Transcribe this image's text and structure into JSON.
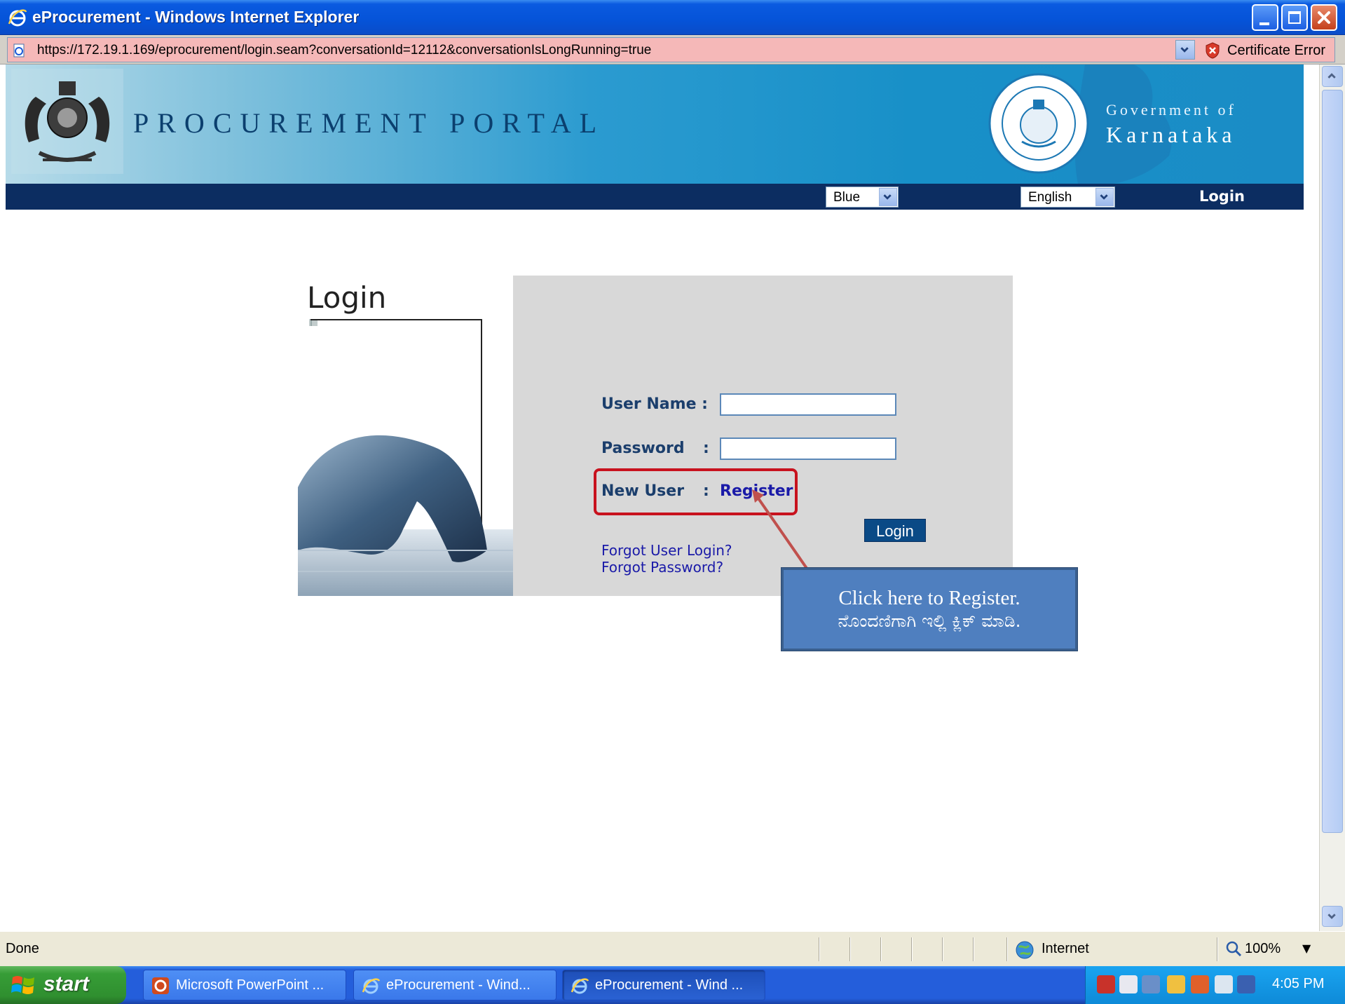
{
  "window": {
    "title": "eProcurement - Windows Internet Explorer"
  },
  "address_bar": {
    "url": "https://172.19.1.169/eprocurement/login.seam?conversationId=12112&conversationIsLongRunning=true",
    "certificate_status": "Certificate Error"
  },
  "header": {
    "portal_title": "PROCUREMENT PORTAL",
    "government_line1": "Government of",
    "government_line2": "Karnataka"
  },
  "navbar": {
    "theme_select": "Blue",
    "language_select": "English",
    "login_link": "Login"
  },
  "login": {
    "heading": "Login",
    "username_label": "User Name :",
    "password_label": "Password",
    "password_colon": ":",
    "username_value": "",
    "password_value": "",
    "new_user_label": "New User",
    "new_user_colon": ":",
    "register_link": "Register",
    "login_button": "Login",
    "forgot_user_login": "Forgot User Login?",
    "forgot_password": "Forgot Password?"
  },
  "callout": {
    "line1": "Click here to Register.",
    "line2": "ನೊಂದಣಿಗಾಗಿ ಇಲ್ಲಿ ಕ್ಲಿಕ್ ಮಾಡಿ."
  },
  "statusbar": {
    "status": "Done",
    "zone": "Internet",
    "zoom": "100%"
  },
  "taskbar": {
    "start": "start",
    "tasks": [
      {
        "label": "Microsoft PowerPoint ..."
      },
      {
        "label": "eProcurement - Wind..."
      },
      {
        "label": "eProcurement - Wind ..."
      }
    ],
    "clock": "4:05 PM"
  },
  "colors": {
    "nav_bg": "#0c2d61",
    "panel_bg": "#d8d8d8",
    "label_color": "#1b3e6c",
    "link_color": "#1a1aa8",
    "highlight_red": "#c8121e",
    "callout_bg": "#4f7fbf"
  }
}
